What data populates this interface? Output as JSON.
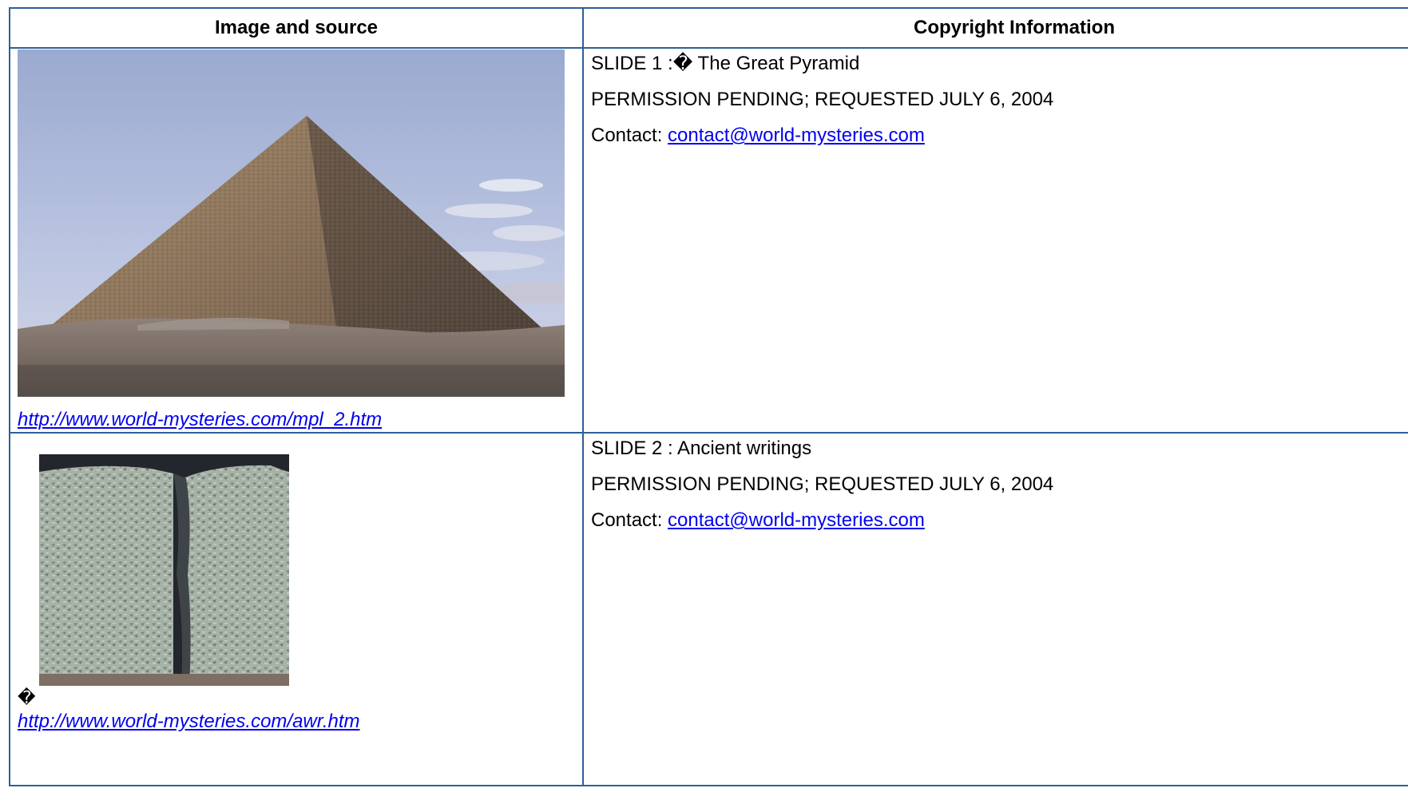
{
  "table": {
    "headers": {
      "image_and_source": "Image and source",
      "copyright_information": "Copyright Information"
    },
    "rows": [
      {
        "image_icon": "great-pyramid-photo",
        "source_url": "http://www.world-mysteries.com/mpl_2.htm",
        "slide_title": "SLIDE 1 :� The Great Pyramid",
        "permission": "PERMISSION PENDING; REQUESTED JULY 6, 2004",
        "contact_label": "Contact: ",
        "contact_email": "contact@world-mysteries.com"
      },
      {
        "leading_glyph": "�",
        "image_icon": "cuneiform-tablet-photo",
        "source_url": "http://www.world-mysteries.com/awr.htm",
        "slide_title": "SLIDE 2 : Ancient writings",
        "permission": "PERMISSION PENDING; REQUESTED JULY 6, 2004",
        "contact_label": "Contact: ",
        "contact_email": "contact@world-mysteries.com"
      }
    ]
  },
  "colors": {
    "border": "#2e5f96",
    "link": "#0000ee"
  }
}
